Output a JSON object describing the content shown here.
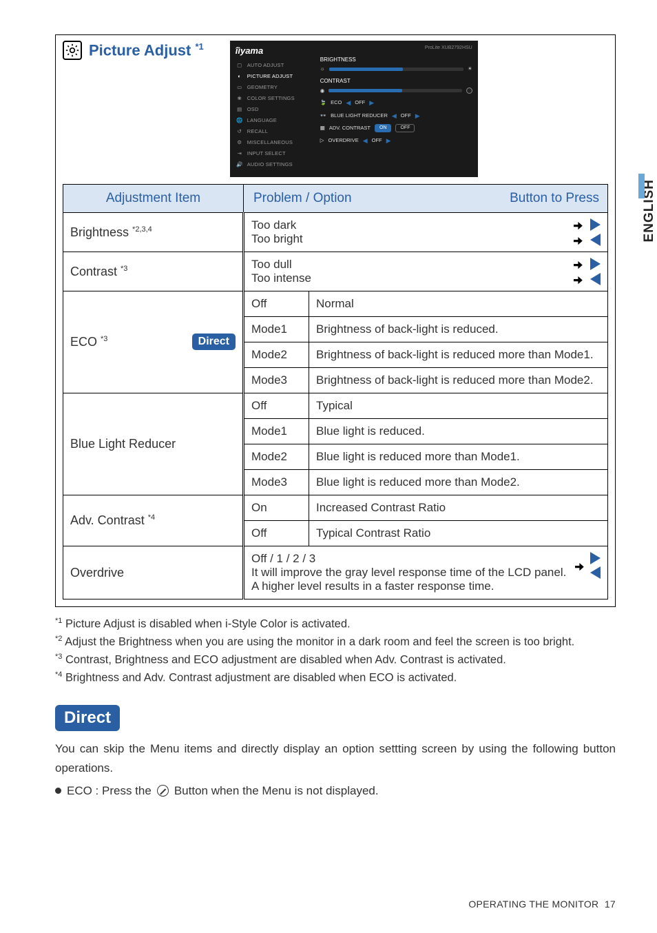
{
  "title": {
    "text": "Picture Adjust ",
    "sup": "*1"
  },
  "osd": {
    "brand": "îìyama",
    "model": "ProLite XUB2792HSU",
    "left_menu": [
      "AUTO ADJUST",
      "PICTURE ADJUST",
      "GEOMETRY",
      "COLOR SETTINGS",
      "OSD",
      "LANGUAGE",
      "RECALL",
      "MISCELLANEOUS",
      "INPUT SELECT",
      "AUDIO SETTINGS"
    ],
    "right_rows": {
      "brightness": "BRIGHTNESS",
      "contrast": "CONTRAST",
      "eco": "ECO",
      "blr": "BLUE LIGHT REDUCER",
      "advc": "ADV. CONTRAST",
      "over": "OVERDRIVE",
      "off": "OFF",
      "on": "ON"
    }
  },
  "table": {
    "head": {
      "item": "Adjustment Item",
      "problem": "Problem / Option",
      "button": "Button to Press"
    },
    "brightness": {
      "name": "Brightness ",
      "sup": "*2,3,4",
      "l1": "Too dark",
      "l2": "Too bright"
    },
    "contrast": {
      "name": "Contrast ",
      "sup": "*3",
      "l1": "Too dull",
      "l2": "Too intense"
    },
    "eco": {
      "name": "ECO ",
      "sup": "*3",
      "direct": "Direct",
      "rows": [
        {
          "opt": "Off",
          "desc": "Normal"
        },
        {
          "opt": "Mode1",
          "desc": "Brightness of back-light is reduced."
        },
        {
          "opt": "Mode2",
          "desc": "Brightness of back-light is reduced more than Mode1."
        },
        {
          "opt": "Mode3",
          "desc": "Brightness of back-light is reduced more than Mode2."
        }
      ]
    },
    "blr": {
      "name": "Blue Light Reducer",
      "rows": [
        {
          "opt": "Off",
          "desc": "Typical"
        },
        {
          "opt": "Mode1",
          "desc": "Blue light is reduced."
        },
        {
          "opt": "Mode2",
          "desc": "Blue light is reduced more than Mode1."
        },
        {
          "opt": "Mode3",
          "desc": "Blue light is reduced more than Mode2."
        }
      ]
    },
    "advc": {
      "name": "Adv. Contrast ",
      "sup": "*4",
      "rows": [
        {
          "opt": "On",
          "desc": "Increased Contrast Ratio"
        },
        {
          "opt": "Off",
          "desc": "Typical Contrast Ratio"
        }
      ]
    },
    "overdrive": {
      "name": "Overdrive",
      "l1": "Off / 1 / 2 / 3",
      "l2": "It will improve the gray level response time of the LCD panel.",
      "l3": "A higher level results in a faster response time."
    }
  },
  "footnotes": {
    "f1": {
      "sup": "*1",
      "text": " Picture Adjust is disabled when i-Style Color is activated."
    },
    "f2": {
      "sup": "*2",
      "text": " Adjust the Brightness when you are using the monitor in a dark room and feel the screen is too bright."
    },
    "f3": {
      "sup": "*3",
      "text": " Contrast, Brightness and ECO adjustment are disabled when Adv. Contrast is activated."
    },
    "f4": {
      "sup": "*4",
      "text": " Brightness and Adv. Contrast adjustment are disabled when ECO is activated."
    }
  },
  "direct": {
    "head": "Direct",
    "para": "You can skip the Menu items and directly display an option settting screen by using the following button operations.",
    "bullet_pre": "ECO : Press the ",
    "bullet_post": " Button when the Menu is not displayed."
  },
  "side": "ENGLISH",
  "footer": {
    "label": "OPERATING THE MONITOR",
    "page": "17"
  }
}
